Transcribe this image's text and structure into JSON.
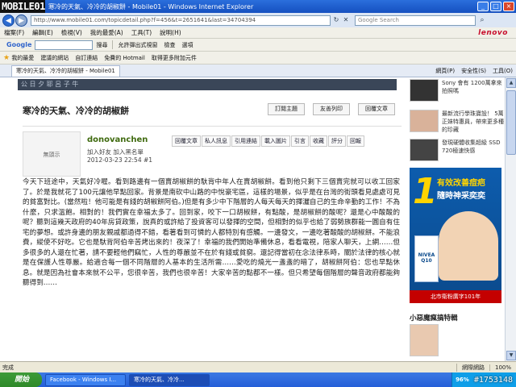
{
  "window": {
    "logo_text": "MOBILE01",
    "title": "寒冷的天氣、冷冷的胡椒餅 - Mobile01 - Windows Internet Explorer",
    "minimize": "_",
    "maximize": "□",
    "close": "×"
  },
  "address_bar": {
    "back": "◀",
    "forward": "▶",
    "url": "http://www.mobile01.com/topicdetail.php?f=456&t=2651641&last=34704394",
    "search_placeholder": "Google Search"
  },
  "menu": {
    "items": [
      "檔案(F)",
      "編輯(E)",
      "檢視(V)",
      "我的最愛(A)",
      "工具(T)",
      "說明(H)"
    ],
    "brand": "lenovo"
  },
  "google_toolbar": {
    "logo": "Google",
    "search_btn": "搜尋",
    "items": [
      "允許彈出式視窗",
      "檢查",
      "選項"
    ]
  },
  "favorites_bar": {
    "favorites": "我的最愛",
    "items": [
      "建議的網站",
      "自訂連結",
      "免費的 Hotmail",
      "取得更多附加元件"
    ]
  },
  "tab": {
    "label": "寒冷的天氣、冷冷的胡椒餅 - Mobile01"
  },
  "commands": [
    "網頁(P)",
    "安全性(S)",
    "工具(O)"
  ],
  "page": {
    "top_strip": "公 日 夕 耶   呂 子   牛",
    "post_title": "寒冷的天氣、冷冷的胡椒餅",
    "actions": [
      "訂閱主題",
      "友善列印",
      "回覆文章"
    ],
    "author": "donovanchen",
    "avatar_text": "無頭示",
    "author_links": "加入好友  加入黑名單",
    "post_time": "2012-03-23 22:54  #1",
    "post_tools": [
      "回覆文章",
      "私人訊息",
      "引用連結",
      "載入圖片",
      "引言",
      "收藏",
      "評分",
      "回報"
    ],
    "body": "今天下班途中，天氣好冷喔。看到路邊有一個賣胡椒餅的馱背中年人在賣胡椒餅。看到他只剩下三個賣完就可以收工回家了。於是我就花了100元讓他早點回家。背景是南砍中山路的中悅豪宅區，這樣的場景，似乎是在台灣的街頭看見處處可見的貧富對比。(當然啦！他可能是有錢的胡椒餅阿伯。)但是有多少中下階層的人每天每天的揮灑自己的生命辛勤的工作！不為什麼，只求溫飽。相對的！我們實在幸福太多了。回到家，咬下一口胡椒餅，有點酸，是胡椒餅的酸呢？還是心中酸酸的呢？聽到這幾天政府的40年房貸政策，說真的或許給了投資客可以發揮的空間，但相對的似乎也給了弱勢族群能一圓自有住宅的夢想。或許身邊的朋友親戚都過得不錯，看著看到可憐的人都特別有感觸。一邊發文，一邊吃著酸酸的胡椒餅。不能浪費，縱使不好吃。它也是馱背阿伯辛苦烤出來的！夜深了！幸福的我們開始準備休息，看看電視，陪家人聊天，上網……但多很多的人還在忙著，請不要輕他們竊忙，人性的尊嚴並不在於有錢或貧窮。還記得當初在念法律系時，關於法律的核心就是在保護人性尊嚴。給適合每一個不同階層的人基本的生活所需……愛吃的燒光一盞盞的暗了，胡椒餅阿伯：您也早點休息。就是因為社會本來就不公平，您很辛苦，我們也很辛苦！大家辛苦的點都不一樣。但只希望每個階層的聲音政府都能夠聽得到……"
  },
  "sidebar": {
    "items": [
      {
        "text": "Sony 會有 1200萬拿來拍照嗎"
      },
      {
        "text": "最新流行學珠寶設！ 5萬正妹特惠員，帶來更多種的珍藏"
      },
      {
        "text": "發現硬體收集超級 SSD 720極速快感"
      }
    ],
    "ad": {
      "number": "1",
      "headline1": "有效改善痘疤",
      "headline2": "隨時神采奕奕",
      "product": "NIVEA Q10",
      "footer": "北市衛粉廣字101年"
    },
    "section_title": "小惡魔瘋搞特輯"
  },
  "status_bar": {
    "text": "完成",
    "zone": "網際網路",
    "zoom": "100%"
  },
  "taskbar": {
    "start": "開始",
    "tasks": [
      "Facebook - Windows I...",
      "寒冷的天氣、冷冷..."
    ],
    "tray_pct": "96%",
    "watermark": "#1753148"
  }
}
